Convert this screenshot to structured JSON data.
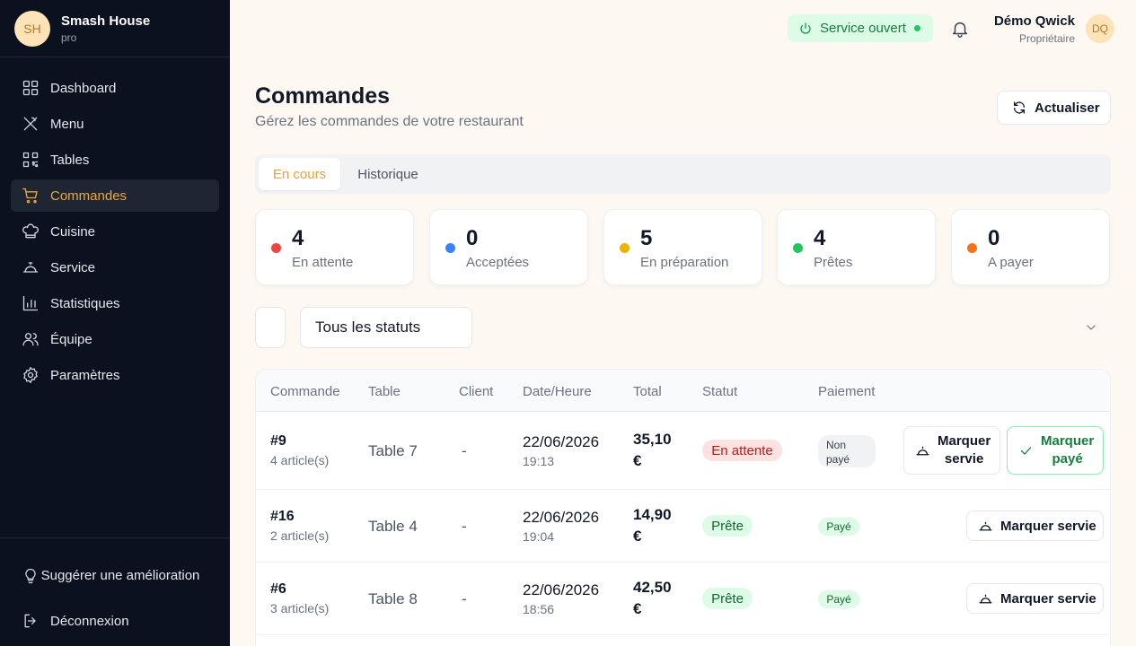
{
  "brand": {
    "initials": "SH",
    "name": "Smash House",
    "plan": "pro"
  },
  "nav": [
    {
      "label": "Dashboard",
      "icon": "dashboard-icon"
    },
    {
      "label": "Menu",
      "icon": "utensils-icon"
    },
    {
      "label": "Tables",
      "icon": "qr-code-icon"
    },
    {
      "label": "Commandes",
      "icon": "cart-icon",
      "active": true
    },
    {
      "label": "Cuisine",
      "icon": "chef-hat-icon"
    },
    {
      "label": "Service",
      "icon": "cloche-icon"
    },
    {
      "label": "Statistiques",
      "icon": "bar-chart-icon"
    },
    {
      "label": "Équipe",
      "icon": "users-icon"
    },
    {
      "label": "Paramètres",
      "icon": "gear-icon"
    }
  ],
  "sidebar_bottom": {
    "suggest": "Suggérer une amélioration",
    "logout": "Déconnexion"
  },
  "header": {
    "service_status": "Service ouvert",
    "user_name": "Démo Qwick",
    "user_role": "Propriétaire",
    "user_initials": "DQ"
  },
  "page": {
    "title": "Commandes",
    "subtitle": "Gérez les commandes de votre restaurant",
    "refresh": "Actualiser"
  },
  "tabs": [
    {
      "label": "En cours"
    },
    {
      "label": "Historique"
    }
  ],
  "stats": [
    {
      "value": "4",
      "label": "En attente",
      "color": "#ef4444"
    },
    {
      "value": "0",
      "label": "Acceptées",
      "color": "#3b82f6"
    },
    {
      "value": "5",
      "label": "En préparation",
      "color": "#eab308"
    },
    {
      "value": "4",
      "label": "Prêtes",
      "color": "#22c55e"
    },
    {
      "value": "0",
      "label": "A payer",
      "color": "#f97316"
    }
  ],
  "filter": {
    "status": "Tous les statuts"
  },
  "table": {
    "columns": [
      "Commande",
      "Table",
      "Client",
      "Date/Heure",
      "Total",
      "Statut",
      "Paiement"
    ],
    "rows": [
      {
        "id": "#9",
        "items": "4 article(s)",
        "table": "Table 7",
        "client": "-",
        "date": "22/06/2026",
        "time": "19:13",
        "total1": "35,10",
        "total2": "€",
        "status": "En attente",
        "payment": "Non payé",
        "payment_l1": "Non",
        "payment_l2": "payé",
        "btn_served_l1": "Marquer",
        "btn_served_l2": "servie",
        "btn_paid_l1": "Marquer",
        "btn_paid_l2": "payé"
      },
      {
        "id": "#16",
        "items": "2 article(s)",
        "table": "Table 4",
        "client": "-",
        "date": "22/06/2026",
        "time": "19:04",
        "total1": "14,90",
        "total2": "€",
        "status": "Prête",
        "payment": "Payé",
        "btn_served": "Marquer servie"
      },
      {
        "id": "#6",
        "items": "3 article(s)",
        "table": "Table 8",
        "client": "-",
        "date": "22/06/2026",
        "time": "18:56",
        "total1": "42,50",
        "total2": "€",
        "status": "Prête",
        "payment": "Payé",
        "btn_served": "Marquer servie"
      }
    ]
  }
}
